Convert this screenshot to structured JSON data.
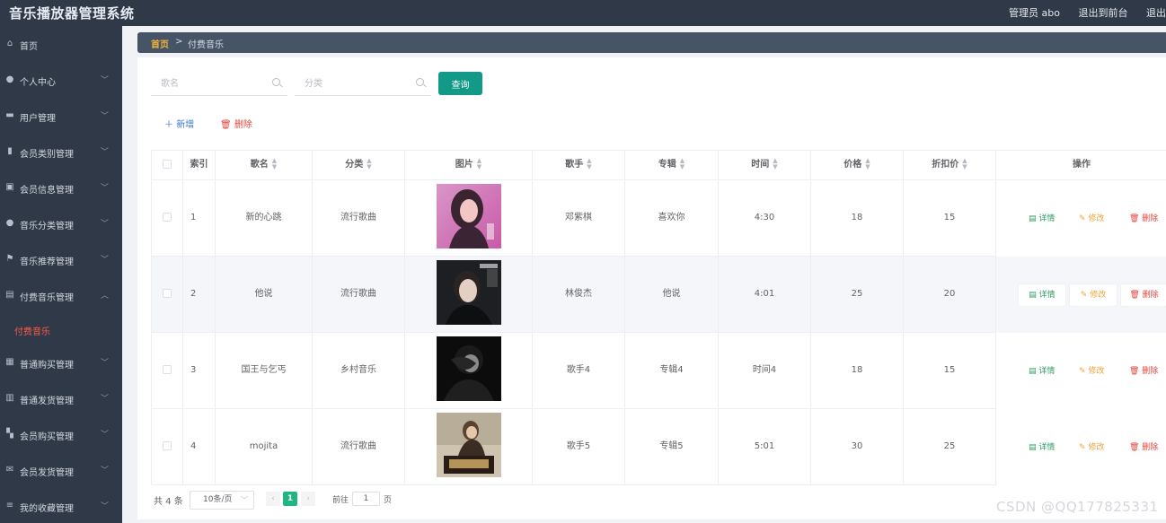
{
  "app": {
    "title": "音乐播放器管理系统",
    "user_label": "管理员 abo",
    "to_front": "退出到前台",
    "logout": "退出"
  },
  "sidebar": {
    "items": [
      {
        "label": "首页",
        "icon": "home-icon",
        "expandable": false
      },
      {
        "label": "个人中心",
        "icon": "user-icon",
        "expandable": true
      },
      {
        "label": "用户管理",
        "icon": "users-icon",
        "expandable": true
      },
      {
        "label": "会员类别管理",
        "icon": "bar-chart-icon",
        "expandable": true
      },
      {
        "label": "会员信息管理",
        "icon": "id-card-icon",
        "expandable": true
      },
      {
        "label": "音乐分类管理",
        "icon": "user-icon",
        "expandable": true
      },
      {
        "label": "音乐推荐管理",
        "icon": "flag-icon",
        "expandable": true
      },
      {
        "label": "付费音乐管理",
        "icon": "wallet-icon",
        "expandable": true,
        "expanded": true
      },
      {
        "label": "普通购买管理",
        "icon": "cart-icon",
        "expandable": true
      },
      {
        "label": "普通发货管理",
        "icon": "package-icon",
        "expandable": true
      },
      {
        "label": "会员购买管理",
        "icon": "grid-icon",
        "expandable": true
      },
      {
        "label": "会员发货管理",
        "icon": "mail-icon",
        "expandable": true
      },
      {
        "label": "我的收藏管理",
        "icon": "sliders-icon",
        "expandable": true
      }
    ],
    "active_sub": "付费音乐"
  },
  "breadcrumb": {
    "home": "首页",
    "separator": ">",
    "current": "付费音乐"
  },
  "search": {
    "name_placeholder": "歌名",
    "category_placeholder": "分类",
    "query_label": "查询"
  },
  "toolbar": {
    "add_label": "新增",
    "delete_label": "删除"
  },
  "table": {
    "columns": [
      "",
      "索引",
      "歌名",
      "分类",
      "图片",
      "歌手",
      "专辑",
      "时间",
      "价格",
      "折扣价",
      "操作"
    ],
    "rows": [
      {
        "index": "1",
        "name": "新的心跳",
        "category": "流行歌曲",
        "image": "portrait-pink",
        "singer": "邓紫棋",
        "album": "喜欢你",
        "time": "4:30",
        "price": "18",
        "discount": "15"
      },
      {
        "index": "2",
        "name": "他说",
        "category": "流行歌曲",
        "image": "portrait-dark",
        "singer": "林俊杰",
        "album": "他说",
        "time": "4:01",
        "price": "25",
        "discount": "20"
      },
      {
        "index": "3",
        "name": "国王与乞丐",
        "category": "乡村音乐",
        "image": "portrait-black",
        "singer": "歌手4",
        "album": "专辑4",
        "time": "时间4",
        "price": "18",
        "discount": "15"
      },
      {
        "index": "4",
        "name": "mojita",
        "category": "流行歌曲",
        "image": "album-jay",
        "singer": "歌手5",
        "album": "专辑5",
        "time": "5:01",
        "price": "30",
        "discount": "25"
      }
    ],
    "actions": {
      "detail": "详情",
      "edit": "修改",
      "delete": "删除"
    }
  },
  "pagination": {
    "total": "共 4 条",
    "page_size": "10条/页",
    "current_page": "1",
    "goto_label": "前往",
    "goto_value": "1",
    "page_unit": "页"
  },
  "watermark": "CSDN @QQ177825331",
  "colors": {
    "nav_bg": "#2f3947",
    "accent": "#129987",
    "active_sub": "#ff5a4a",
    "crumb_home": "#f0b23c"
  }
}
